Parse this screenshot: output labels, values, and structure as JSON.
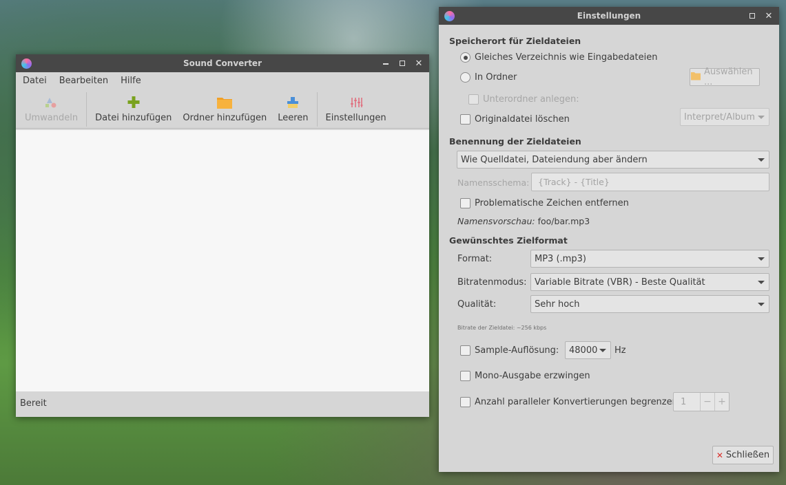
{
  "main_window": {
    "title": "Sound Converter",
    "menu": [
      "Datei",
      "Bearbeiten",
      "Hilfe"
    ],
    "toolbar": {
      "convert": "Umwandeln",
      "add_file": "Datei hinzufügen",
      "add_folder": "Ordner hinzufügen",
      "clear": "Leeren",
      "preferences": "Einstellungen"
    },
    "status": "Bereit"
  },
  "prefs_window": {
    "title": "Einstellungen",
    "location": {
      "heading": "Speicherort für Zieldateien",
      "same_folder": "Gleiches Verzeichnis wie Eingabedateien",
      "in_folder": "In Ordner",
      "choose_button": "Auswählen ...",
      "subfolder_label": "Unterordner anlegen:",
      "subfolder_value": "Interpret/Album",
      "delete_original": "Originaldatei löschen"
    },
    "naming": {
      "heading": "Benennung der Zieldateien",
      "scheme_value": "Wie Quelldatei, Dateiendung aber ändern",
      "pattern_label": "Namensschema:",
      "pattern_value": "{Track} - {Title}",
      "remove_chars": "Problematische Zeichen entfernen",
      "preview_label": "Namensvorschau:",
      "preview_value": "foo/bar.mp3"
    },
    "format": {
      "heading": "Gewünschtes Zielformat",
      "format_label": "Format:",
      "format_value": "MP3 (.mp3)",
      "bitrate_mode_label": "Bitratenmodus:",
      "bitrate_mode_value": "Variable Bitrate (VBR) - Beste Qualität",
      "quality_label": "Qualität:",
      "quality_value": "Sehr hoch",
      "bitrate_note": "Bitrate der Zieldatei: ~256 kbps",
      "resample_label": "Sample-Auflösung:",
      "resample_value": "48000",
      "resample_unit": "Hz",
      "mono_label": "Mono-Ausgabe erzwingen",
      "parallel_label": "Anzahl paralleler Konvertierungen begrenzen",
      "parallel_value": "1"
    },
    "close_button": "Schließen"
  },
  "colors": {
    "titlebar": "#474747",
    "window_bg": "#d6d6d6",
    "list_bg": "#f7f7f7",
    "close_x": "#d9302b"
  }
}
